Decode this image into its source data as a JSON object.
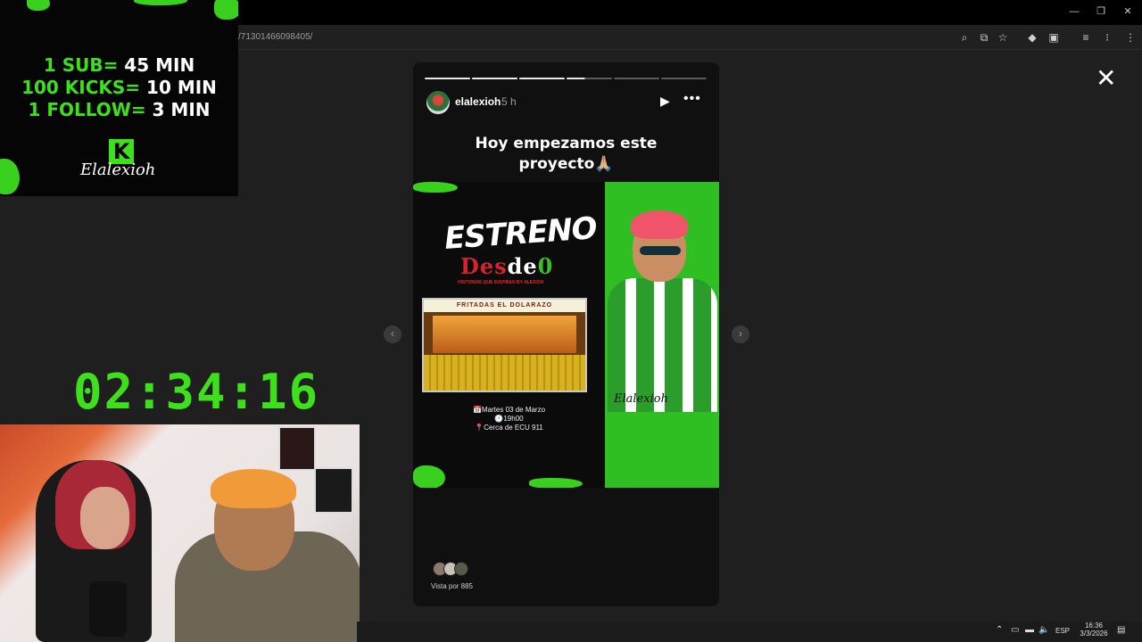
{
  "browser": {
    "url": "/71301466098405/",
    "window_controls": [
      "minimize-icon",
      "restore-icon",
      "close-icon"
    ],
    "toolbar_icons": [
      "zoom-icon",
      "install-app-icon",
      "bookmark-star-icon",
      "extension-diamond-icon",
      "extensions-puzzle-icon",
      "media-control-icon",
      "split-icon",
      "menu-dots-icon"
    ]
  },
  "stream_overlay": {
    "rates": [
      {
        "label": "1 SUB=",
        "value": " 45 MIN"
      },
      {
        "label": "100 KICKS=",
        "value": " 10 MIN"
      },
      {
        "label": "1 FOLLOW=",
        "value": " 3 MIN"
      }
    ],
    "logo_letter": "K",
    "brand": "Elalexioh",
    "timer": "02:34:16"
  },
  "story": {
    "username": "elalexioh",
    "time_ago": "5 h",
    "progress": {
      "total": 6,
      "completed": 3,
      "current_fraction": 0.4
    },
    "caption_line1": "Hoy empezamos este",
    "caption_line2": "proyecto🙏🏼",
    "poster": {
      "title": "ESTRENO",
      "subtitle": [
        "Des",
        "de",
        "0"
      ],
      "tagline": "HISTORIAS QUE INSPIRAN BY ALEXIOH",
      "stand_sign": "FRITADAS    EL DOLARAZO",
      "date": "📅Martes 03 de Marzo",
      "time": "🕐19h00",
      "location": "📍Cerca de ECU 911",
      "brand": "Elalexioh"
    },
    "viewers": "Vista por 885"
  },
  "taskbar": {
    "language": "ESP",
    "clock_time": "16:36",
    "clock_date": "3/3/2026"
  },
  "colors": {
    "kick_green": "#3ee01b",
    "background": "#1e1e1e"
  }
}
